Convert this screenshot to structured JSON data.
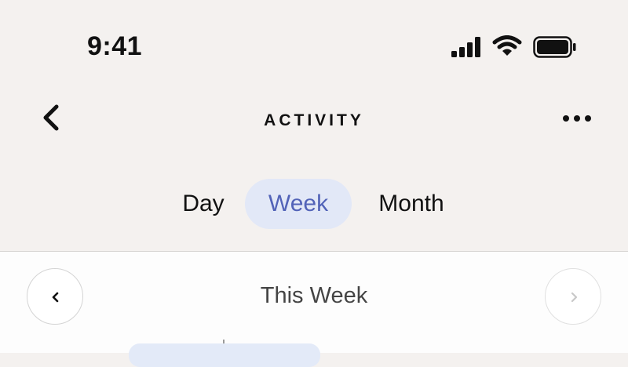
{
  "status_bar": {
    "time": "9:41",
    "signal_icon": "cellular-signal-icon",
    "wifi_icon": "wifi-icon",
    "battery_icon": "battery-full-icon"
  },
  "nav": {
    "title": "ACTIVITY",
    "back_icon": "chevron-left-icon",
    "more_icon": "ellipsis-icon"
  },
  "segments": {
    "items": [
      {
        "label": "Day",
        "selected": false
      },
      {
        "label": "Week",
        "selected": true
      },
      {
        "label": "Month",
        "selected": false
      }
    ]
  },
  "period": {
    "label": "This Week",
    "prev_icon": "chevron-left-icon",
    "next_icon": "chevron-right-icon",
    "next_enabled": false
  },
  "colors": {
    "background": "#f4f1ef",
    "accent": "#5263b8",
    "accent_bg": "#e2e8f7",
    "content_bg": "#fdfdfd"
  }
}
